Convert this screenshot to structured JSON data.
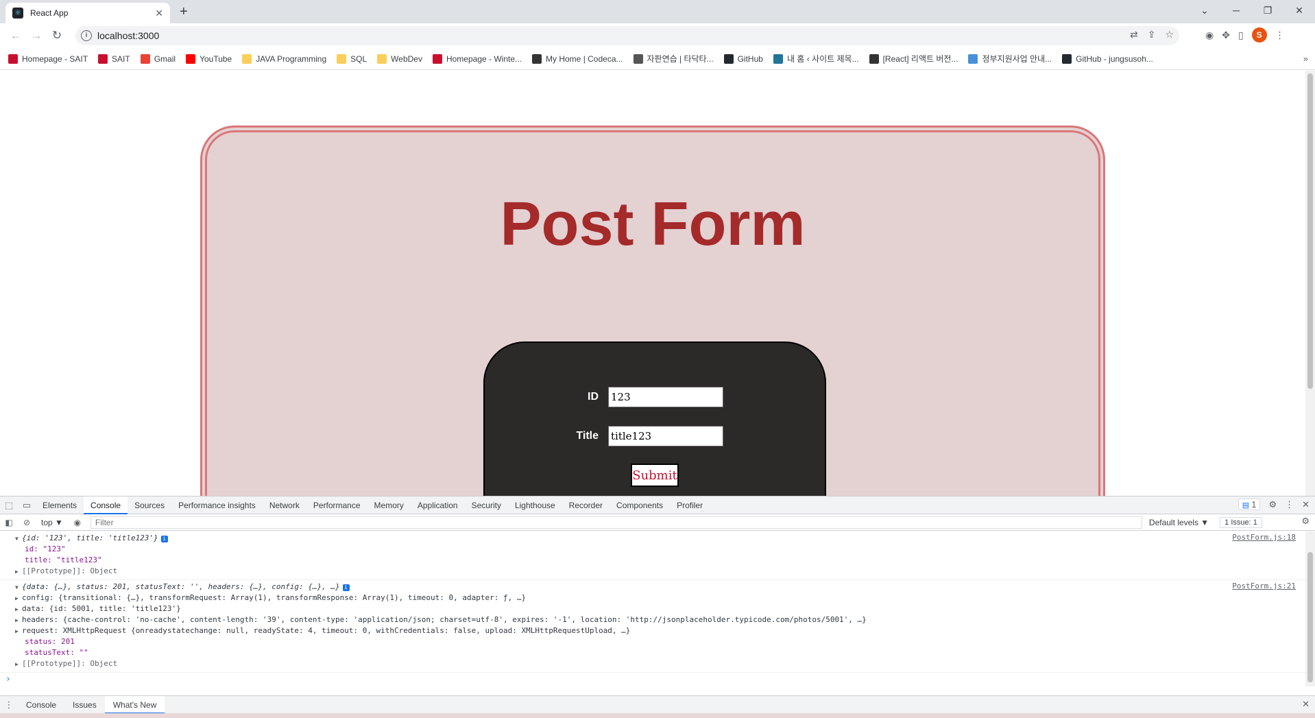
{
  "browser": {
    "tab_title": "React App",
    "new_tab_icon": "+",
    "url": "localhost:3000",
    "bookmarks": [
      {
        "label": "Homepage - SAIT",
        "icon_color": "#c8102e",
        "icon": "sait-icon"
      },
      {
        "label": "SAIT",
        "icon_color": "#c8102e",
        "icon": "sait-icon"
      },
      {
        "label": "Gmail",
        "icon_color": "#ea4335",
        "icon": "gmail-icon"
      },
      {
        "label": "YouTube",
        "icon_color": "#ff0000",
        "icon": "youtube-icon"
      },
      {
        "label": "JAVA Programming",
        "icon_color": "#f9ce5a",
        "icon": "folder-icon"
      },
      {
        "label": "SQL",
        "icon_color": "#f9ce5a",
        "icon": "folder-icon"
      },
      {
        "label": "WebDev",
        "icon_color": "#f9ce5a",
        "icon": "folder-icon"
      },
      {
        "label": "Homepage - Winte...",
        "icon_color": "#c8102e",
        "icon": "sait-icon"
      },
      {
        "label": "My Home | Codeca...",
        "icon_color": "#333333",
        "icon": "codecademy-icon"
      },
      {
        "label": "자판연습 | 타닥타...",
        "icon_color": "#555555",
        "icon": "keyboard-icon"
      },
      {
        "label": "GitHub",
        "icon_color": "#24292f",
        "icon": "github-icon"
      },
      {
        "label": "내 홈 ‹ 사이트 제목...",
        "icon_color": "#21759b",
        "icon": "wordpress-icon"
      },
      {
        "label": "[React] 리액트 버전...",
        "icon_color": "#333333",
        "icon": "velog-icon"
      },
      {
        "label": "정부지원사업 안내...",
        "icon_color": "#4a90d9",
        "icon": "gov-icon"
      },
      {
        "label": "GitHub - jungsusoh...",
        "icon_color": "#24292f",
        "icon": "github-icon"
      }
    ],
    "profile_initial": "S"
  },
  "page": {
    "title": "Post Form",
    "form": {
      "id_label": "ID",
      "id_value": "123",
      "title_label": "Title",
      "title_value": "title123",
      "submit_label": "Submit"
    },
    "colors": {
      "card_bg": "#e4d1d2",
      "card_border": "#d97779",
      "title": "#a52a2a",
      "form_bg": "#2c2929",
      "submit_text": "#c8102e"
    }
  },
  "devtools": {
    "tabs": [
      "Elements",
      "Console",
      "Sources",
      "Performance insights",
      "Network",
      "Performance",
      "Memory",
      "Application",
      "Security",
      "Lighthouse",
      "Recorder",
      "Components",
      "Profiler"
    ],
    "active_tab": "Console",
    "message_count": "1",
    "context": "top ▼",
    "filter_placeholder": "Filter",
    "levels": "Default levels ▼",
    "issues": "1 Issue: 1",
    "logs": [
      {
        "source": "PostForm.js:18",
        "summary": "{id: '123', title: 'title123'}",
        "lines": [
          "id: \"123\"",
          "title: \"title123\"",
          "[[Prototype]]: Object"
        ]
      },
      {
        "source": "PostForm.js:21",
        "summary": "{data: {…}, status: 201, statusText: '', headers: {…}, config: {…}, …}",
        "lines": [
          "config: {transitional: {…}, transformRequest: Array(1), transformResponse: Array(1), timeout: 0, adapter: ƒ, …}",
          "data: {id: 5001, title: 'title123'}",
          "headers: {cache-control: 'no-cache', content-length: '39', content-type: 'application/json; charset=utf-8', expires: '-1', location: 'http://jsonplaceholder.typicode.com/photos/5001', …}",
          "request: XMLHttpRequest {onreadystatechange: null, readyState: 4, timeout: 0, withCredentials: false, upload: XMLHttpRequestUpload, …}",
          "status: 201",
          "statusText: \"\"",
          "[[Prototype]]: Object"
        ]
      }
    ],
    "prompt": "›",
    "drawer_tabs": [
      "Console",
      "Issues",
      "What's New"
    ],
    "drawer_active": "What's New"
  }
}
